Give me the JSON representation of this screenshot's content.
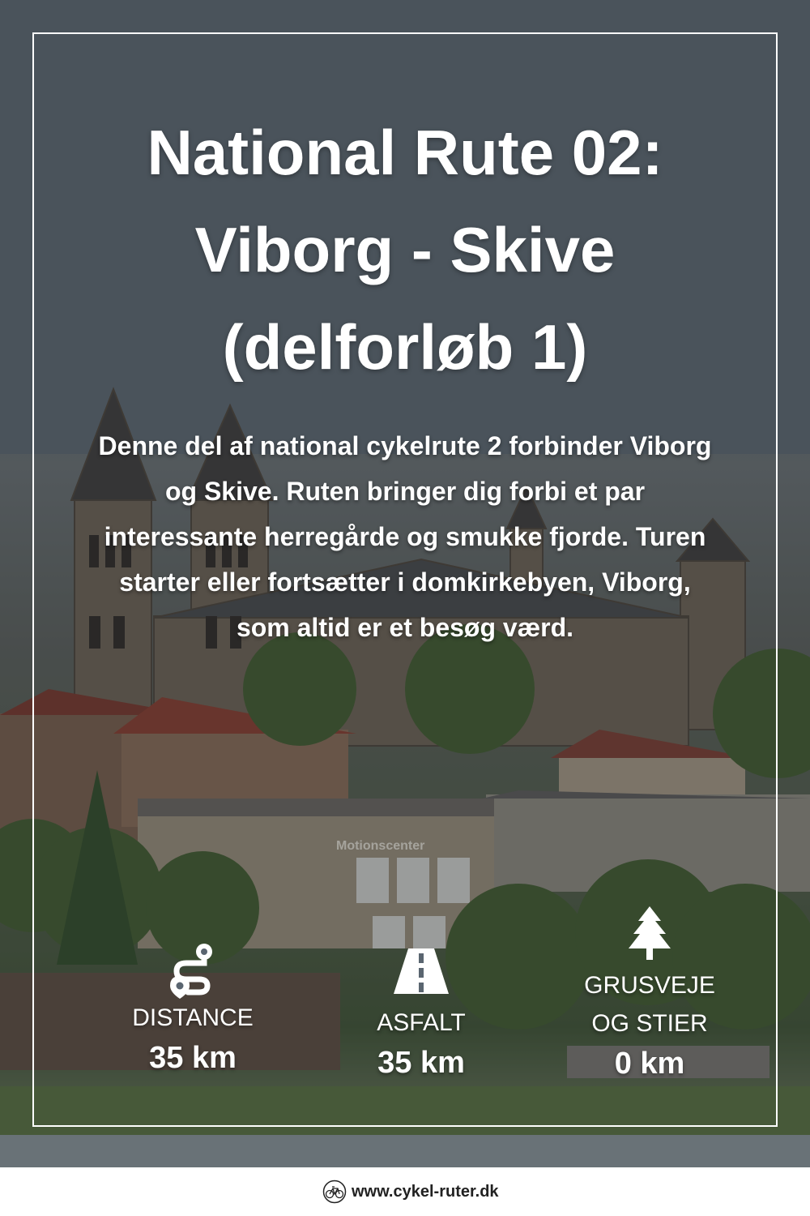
{
  "title": {
    "line1": "National Rute 02:",
    "line2": "Viborg - Skive",
    "line3": "(delforløb 1)"
  },
  "description": "Denne del af national cykelrute 2 forbinder Viborg og Skive. Ruten bringer dig forbi et par interessante herregårde og smukke fjorde. Turen starter eller fortsætter i domkirkebyen, Viborg, som altid er et besøg værd.",
  "background_sign": "Motionscenter",
  "stats": [
    {
      "icon": "route-icon",
      "label_line1": "DISTANCE",
      "value": "35 km"
    },
    {
      "icon": "road-icon",
      "label_line1": "ASFALT",
      "value": "35 km"
    },
    {
      "icon": "tree-icon",
      "label_line1": "GRUSVEJE",
      "label_line2": "OG STIER",
      "value": "0 km"
    }
  ],
  "footer": {
    "logo_icon": "bicycle-logo-icon",
    "url": "www.cykel-ruter.dk"
  },
  "colors": {
    "text": "#ffffff",
    "frame": "#ffffff",
    "footer_bg": "#ffffff",
    "footer_text": "#222222"
  }
}
